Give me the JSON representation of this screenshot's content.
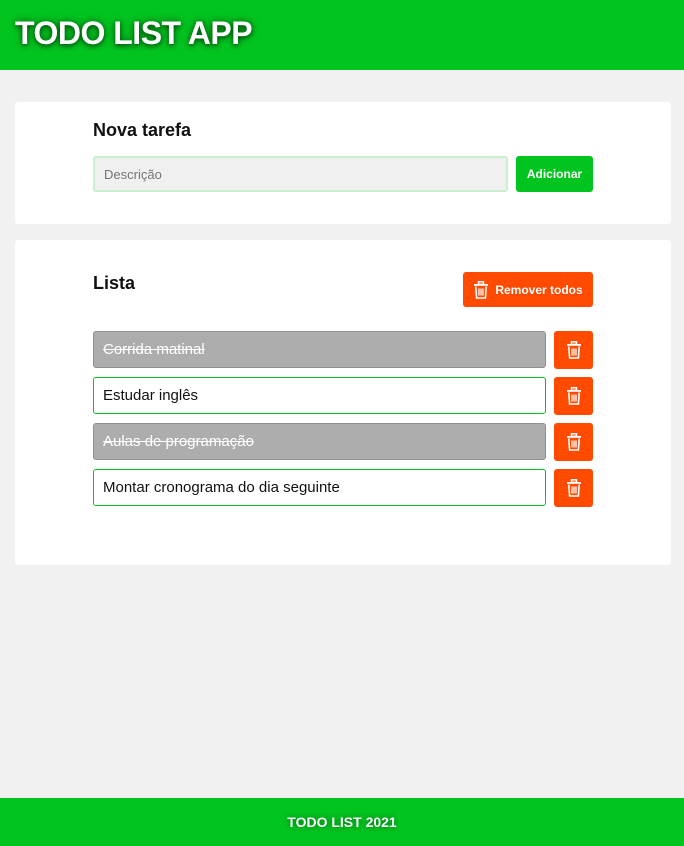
{
  "header": {
    "title": "TODO LIST APP"
  },
  "new_task": {
    "title": "Nova tarefa",
    "input_placeholder": "Descrição",
    "input_value": "",
    "add_label": "Adicionar"
  },
  "list": {
    "title": "Lista",
    "remove_all_label": "Remover todos",
    "items": [
      {
        "text": "Corrida matinal",
        "done": true
      },
      {
        "text": "Estudar inglês",
        "done": false
      },
      {
        "text": "Aulas de programação",
        "done": true
      },
      {
        "text": "Montar cronograma do dia seguinte",
        "done": false
      }
    ]
  },
  "footer": {
    "text": "TODO LIST 2021"
  },
  "colors": {
    "primary": "#02c41f",
    "danger": "#ff4a00",
    "done_item": "#adadad",
    "background": "#f1f1f1"
  },
  "icons": {
    "delete": "trash-icon",
    "remove_all": "trash-icon"
  }
}
